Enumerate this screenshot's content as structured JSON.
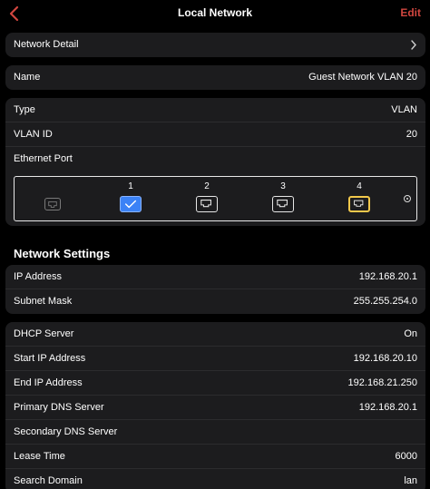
{
  "nav": {
    "title": "Local Network",
    "edit_label": "Edit",
    "accent": "#d0463f"
  },
  "network_detail": {
    "label": "Network Detail"
  },
  "name": {
    "label": "Name",
    "value": "Guest Network VLAN 20"
  },
  "info": {
    "type_label": "Type",
    "type_value": "VLAN",
    "vlan_label": "VLAN ID",
    "vlan_value": "20",
    "eth_label": "Ethernet Port"
  },
  "ports": [
    {
      "num": "",
      "state": "disabled",
      "icon": "ethernet-port-icon"
    },
    {
      "num": "1",
      "state": "checked",
      "icon": "checkmark-icon"
    },
    {
      "num": "2",
      "state": "normal",
      "icon": "ethernet-port-icon"
    },
    {
      "num": "3",
      "state": "normal",
      "icon": "ethernet-port-icon"
    },
    {
      "num": "4",
      "state": "selected",
      "icon": "ethernet-port-icon"
    }
  ],
  "network_settings": {
    "title": "Network Settings",
    "ip_label": "IP Address",
    "ip_value": "192.168.20.1",
    "mask_label": "Subnet Mask",
    "mask_value": "255.255.254.0"
  },
  "dhcp": {
    "server_label": "DHCP Server",
    "server_value": "On",
    "start_label": "Start IP Address",
    "start_value": "192.168.20.10",
    "end_label": "End IP Address",
    "end_value": "192.168.21.250",
    "pdns_label": "Primary DNS Server",
    "pdns_value": "192.168.20.1",
    "sdns_label": "Secondary DNS Server",
    "sdns_value": "",
    "lease_label": "Lease Time",
    "lease_value": "6000",
    "domain_label": "Search Domain",
    "domain_value": "lan"
  }
}
